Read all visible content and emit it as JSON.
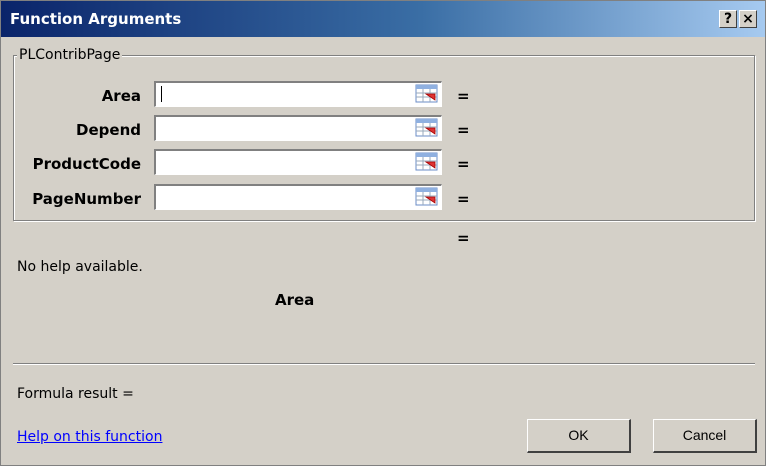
{
  "window": {
    "title": "Function Arguments",
    "help_glyph": "?",
    "close_glyph": "×"
  },
  "function_group": {
    "label": "PLContribPage",
    "args": [
      {
        "label": "Area",
        "value": "",
        "result": "="
      },
      {
        "label": "Depend",
        "value": "",
        "result": "="
      },
      {
        "label": "ProductCode",
        "value": "",
        "result": "="
      },
      {
        "label": "PageNumber",
        "value": "",
        "result": "="
      }
    ],
    "overall_result": "="
  },
  "help_text": "No help available.",
  "current_arg_name": "Area",
  "formula_result_label": "Formula result =",
  "help_link": "Help on this function",
  "buttons": {
    "ok": "OK",
    "cancel": "Cancel"
  },
  "colors": {
    "title_bar_start": "#0a246a",
    "title_bar_end": "#a6caf0",
    "dialog_face": "#d4d0c8",
    "link": "#0000ff"
  },
  "icons": {
    "range_selector": "collapse-dialog-icon"
  }
}
